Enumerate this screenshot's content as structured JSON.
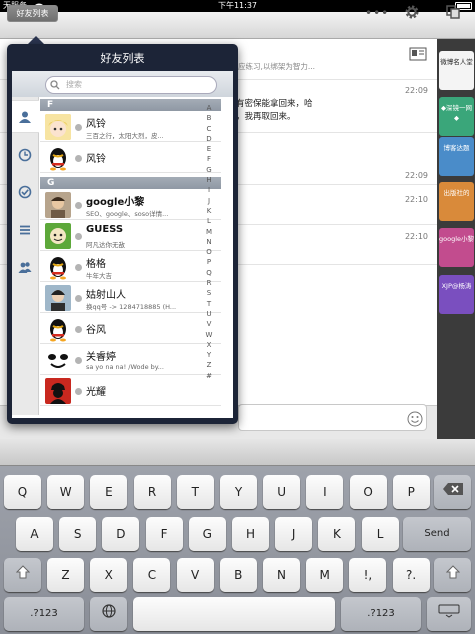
{
  "status": {
    "carrier": "无服务",
    "time": "下午11:37"
  },
  "navbar": {
    "friends_button": "好友列表",
    "more_icon": "more-icon",
    "gear_icon": "gear-icon",
    "copy_icon": "copy-icon"
  },
  "chat": {
    "top_text": "应练习,以绑架为智力...",
    "messages": [
      {
        "time": "22:09",
        "text": [
          "有密保能拿回来，哈",
          "，我再取回来。"
        ]
      },
      {
        "time": "22:09",
        "text": []
      },
      {
        "time": "22:10",
        "text": []
      },
      {
        "time": "22:10",
        "text": []
      }
    ]
  },
  "right_tabs": [
    {
      "label": "微博名人堂",
      "color": "#f4f4f4",
      "text_color": "#222"
    },
    {
      "label": "◆深镜一网◆",
      "color": "#3aa67a",
      "text_color": "#fff"
    },
    {
      "label": "博客达题",
      "color": "#4a8cc9",
      "text_color": "#fff"
    },
    {
      "label": "出版社的",
      "color": "#d98a3a",
      "text_color": "#fff"
    },
    {
      "label": "google小黎",
      "color": "#c24c8e",
      "text_color": "#fff"
    },
    {
      "label": "XJP@杨涛",
      "color": "#7a4fbf",
      "text_color": "#fff"
    }
  ],
  "popover": {
    "title": "好友列表",
    "search_placeholder": "搜索",
    "sections": [
      {
        "letter": "F",
        "rows": [
          {
            "name": "风铃",
            "sub": "三百之行，太阳大烈，皮...",
            "avatar": "blonde-anime-avatar"
          },
          {
            "name": "风铃",
            "sub": "",
            "avatar": "penguin-avatar"
          }
        ]
      },
      {
        "letter": "G",
        "rows": [
          {
            "name": "google小黎",
            "sub": "SEO、google、soso详情...",
            "avatar": "photo-avatar"
          },
          {
            "name": "GUESS",
            "sub": "阿凡达你无敌",
            "avatar": "green-avatar"
          },
          {
            "name": "格格",
            "sub": "牛年大吉",
            "avatar": "penguin-avatar"
          },
          {
            "name": "姑射山人",
            "sub": "换qq号 -> 1284718885 (H...",
            "avatar": "photo-avatar"
          },
          {
            "name": "谷风",
            "sub": "",
            "avatar": "penguin-avatar"
          },
          {
            "name": "关睿婷",
            "sub": "sa yo na na! /Wode by...",
            "avatar": "cartoon-avatar"
          },
          {
            "name": "光耀",
            "sub": "",
            "avatar": "che-avatar"
          }
        ]
      }
    ],
    "index": [
      "A",
      "B",
      "C",
      "D",
      "E",
      "F",
      "G",
      "H",
      "I",
      "J",
      "K",
      "L",
      "M",
      "N",
      "O",
      "P",
      "Q",
      "R",
      "S",
      "T",
      "U",
      "V",
      "W",
      "X",
      "Y",
      "Z",
      "#"
    ]
  },
  "keyboard": {
    "row1": [
      "Q",
      "W",
      "E",
      "R",
      "T",
      "Y",
      "U",
      "I",
      "O",
      "P"
    ],
    "row2": [
      "A",
      "S",
      "D",
      "F",
      "G",
      "H",
      "J",
      "K",
      "L"
    ],
    "row3": [
      "Z",
      "X",
      "C",
      "V",
      "B",
      "N",
      "M",
      "!,",
      "?."
    ],
    "send": "Send",
    "num_left": ".?123",
    "num_right": ".?123"
  }
}
